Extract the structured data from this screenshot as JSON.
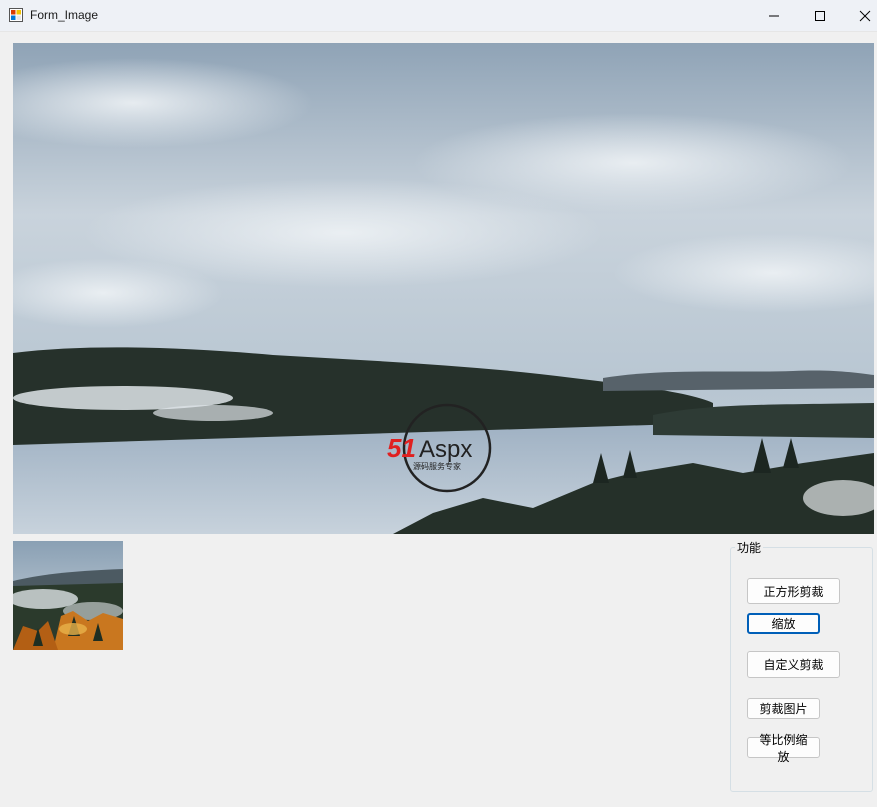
{
  "window": {
    "title": "Form_Image",
    "controls": {
      "minimize": "minimize-icon",
      "maximize": "maximize-icon",
      "close": "close-icon"
    }
  },
  "main_image": {
    "logo_text": "51Aspx",
    "logo_subtitle": "源码服务专家"
  },
  "group": {
    "legend": "功能",
    "buttons": {
      "square_crop": "正方形剪裁",
      "zoom": "缩放",
      "custom_crop": "自定义剪裁",
      "crop_image": "剪裁图片",
      "ratio_zoom": "等比例缩放"
    },
    "focused": "zoom"
  }
}
